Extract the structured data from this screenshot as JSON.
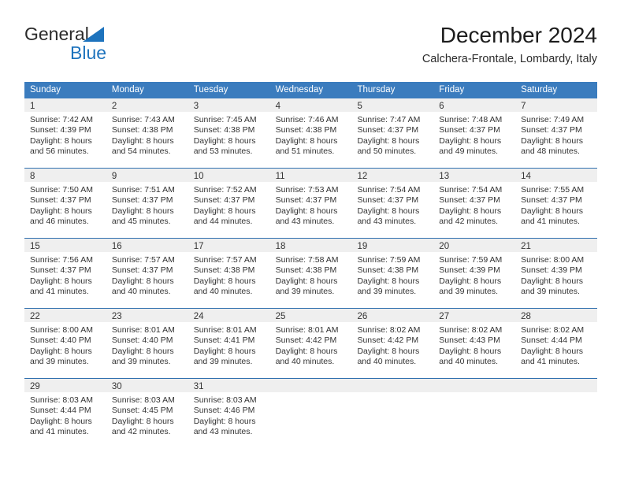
{
  "brand": {
    "name_part1": "General",
    "name_part2": "Blue",
    "icon": "triangle-logo-icon",
    "color_primary": "#1d73bd",
    "color_text": "#2b2b2b"
  },
  "header": {
    "title": "December 2024",
    "subtitle": "Calchera-Frontale, Lombardy, Italy"
  },
  "theme": {
    "header_blue": "#3b7cbe",
    "row_divider_blue": "#2f6fae",
    "day_band_gray": "#efefef",
    "text": "#333333"
  },
  "weekdays": [
    "Sunday",
    "Monday",
    "Tuesday",
    "Wednesday",
    "Thursday",
    "Friday",
    "Saturday"
  ],
  "weeks": [
    [
      {
        "day": "1",
        "sunrise": "Sunrise: 7:42 AM",
        "sunset": "Sunset: 4:39 PM",
        "daylight_1": "Daylight: 8 hours",
        "daylight_2": "and 56 minutes."
      },
      {
        "day": "2",
        "sunrise": "Sunrise: 7:43 AM",
        "sunset": "Sunset: 4:38 PM",
        "daylight_1": "Daylight: 8 hours",
        "daylight_2": "and 54 minutes."
      },
      {
        "day": "3",
        "sunrise": "Sunrise: 7:45 AM",
        "sunset": "Sunset: 4:38 PM",
        "daylight_1": "Daylight: 8 hours",
        "daylight_2": "and 53 minutes."
      },
      {
        "day": "4",
        "sunrise": "Sunrise: 7:46 AM",
        "sunset": "Sunset: 4:38 PM",
        "daylight_1": "Daylight: 8 hours",
        "daylight_2": "and 51 minutes."
      },
      {
        "day": "5",
        "sunrise": "Sunrise: 7:47 AM",
        "sunset": "Sunset: 4:37 PM",
        "daylight_1": "Daylight: 8 hours",
        "daylight_2": "and 50 minutes."
      },
      {
        "day": "6",
        "sunrise": "Sunrise: 7:48 AM",
        "sunset": "Sunset: 4:37 PM",
        "daylight_1": "Daylight: 8 hours",
        "daylight_2": "and 49 minutes."
      },
      {
        "day": "7",
        "sunrise": "Sunrise: 7:49 AM",
        "sunset": "Sunset: 4:37 PM",
        "daylight_1": "Daylight: 8 hours",
        "daylight_2": "and 48 minutes."
      }
    ],
    [
      {
        "day": "8",
        "sunrise": "Sunrise: 7:50 AM",
        "sunset": "Sunset: 4:37 PM",
        "daylight_1": "Daylight: 8 hours",
        "daylight_2": "and 46 minutes."
      },
      {
        "day": "9",
        "sunrise": "Sunrise: 7:51 AM",
        "sunset": "Sunset: 4:37 PM",
        "daylight_1": "Daylight: 8 hours",
        "daylight_2": "and 45 minutes."
      },
      {
        "day": "10",
        "sunrise": "Sunrise: 7:52 AM",
        "sunset": "Sunset: 4:37 PM",
        "daylight_1": "Daylight: 8 hours",
        "daylight_2": "and 44 minutes."
      },
      {
        "day": "11",
        "sunrise": "Sunrise: 7:53 AM",
        "sunset": "Sunset: 4:37 PM",
        "daylight_1": "Daylight: 8 hours",
        "daylight_2": "and 43 minutes."
      },
      {
        "day": "12",
        "sunrise": "Sunrise: 7:54 AM",
        "sunset": "Sunset: 4:37 PM",
        "daylight_1": "Daylight: 8 hours",
        "daylight_2": "and 43 minutes."
      },
      {
        "day": "13",
        "sunrise": "Sunrise: 7:54 AM",
        "sunset": "Sunset: 4:37 PM",
        "daylight_1": "Daylight: 8 hours",
        "daylight_2": "and 42 minutes."
      },
      {
        "day": "14",
        "sunrise": "Sunrise: 7:55 AM",
        "sunset": "Sunset: 4:37 PM",
        "daylight_1": "Daylight: 8 hours",
        "daylight_2": "and 41 minutes."
      }
    ],
    [
      {
        "day": "15",
        "sunrise": "Sunrise: 7:56 AM",
        "sunset": "Sunset: 4:37 PM",
        "daylight_1": "Daylight: 8 hours",
        "daylight_2": "and 41 minutes."
      },
      {
        "day": "16",
        "sunrise": "Sunrise: 7:57 AM",
        "sunset": "Sunset: 4:37 PM",
        "daylight_1": "Daylight: 8 hours",
        "daylight_2": "and 40 minutes."
      },
      {
        "day": "17",
        "sunrise": "Sunrise: 7:57 AM",
        "sunset": "Sunset: 4:38 PM",
        "daylight_1": "Daylight: 8 hours",
        "daylight_2": "and 40 minutes."
      },
      {
        "day": "18",
        "sunrise": "Sunrise: 7:58 AM",
        "sunset": "Sunset: 4:38 PM",
        "daylight_1": "Daylight: 8 hours",
        "daylight_2": "and 39 minutes."
      },
      {
        "day": "19",
        "sunrise": "Sunrise: 7:59 AM",
        "sunset": "Sunset: 4:38 PM",
        "daylight_1": "Daylight: 8 hours",
        "daylight_2": "and 39 minutes."
      },
      {
        "day": "20",
        "sunrise": "Sunrise: 7:59 AM",
        "sunset": "Sunset: 4:39 PM",
        "daylight_1": "Daylight: 8 hours",
        "daylight_2": "and 39 minutes."
      },
      {
        "day": "21",
        "sunrise": "Sunrise: 8:00 AM",
        "sunset": "Sunset: 4:39 PM",
        "daylight_1": "Daylight: 8 hours",
        "daylight_2": "and 39 minutes."
      }
    ],
    [
      {
        "day": "22",
        "sunrise": "Sunrise: 8:00 AM",
        "sunset": "Sunset: 4:40 PM",
        "daylight_1": "Daylight: 8 hours",
        "daylight_2": "and 39 minutes."
      },
      {
        "day": "23",
        "sunrise": "Sunrise: 8:01 AM",
        "sunset": "Sunset: 4:40 PM",
        "daylight_1": "Daylight: 8 hours",
        "daylight_2": "and 39 minutes."
      },
      {
        "day": "24",
        "sunrise": "Sunrise: 8:01 AM",
        "sunset": "Sunset: 4:41 PM",
        "daylight_1": "Daylight: 8 hours",
        "daylight_2": "and 39 minutes."
      },
      {
        "day": "25",
        "sunrise": "Sunrise: 8:01 AM",
        "sunset": "Sunset: 4:42 PM",
        "daylight_1": "Daylight: 8 hours",
        "daylight_2": "and 40 minutes."
      },
      {
        "day": "26",
        "sunrise": "Sunrise: 8:02 AM",
        "sunset": "Sunset: 4:42 PM",
        "daylight_1": "Daylight: 8 hours",
        "daylight_2": "and 40 minutes."
      },
      {
        "day": "27",
        "sunrise": "Sunrise: 8:02 AM",
        "sunset": "Sunset: 4:43 PM",
        "daylight_1": "Daylight: 8 hours",
        "daylight_2": "and 40 minutes."
      },
      {
        "day": "28",
        "sunrise": "Sunrise: 8:02 AM",
        "sunset": "Sunset: 4:44 PM",
        "daylight_1": "Daylight: 8 hours",
        "daylight_2": "and 41 minutes."
      }
    ],
    [
      {
        "day": "29",
        "sunrise": "Sunrise: 8:03 AM",
        "sunset": "Sunset: 4:44 PM",
        "daylight_1": "Daylight: 8 hours",
        "daylight_2": "and 41 minutes."
      },
      {
        "day": "30",
        "sunrise": "Sunrise: 8:03 AM",
        "sunset": "Sunset: 4:45 PM",
        "daylight_1": "Daylight: 8 hours",
        "daylight_2": "and 42 minutes."
      },
      {
        "day": "31",
        "sunrise": "Sunrise: 8:03 AM",
        "sunset": "Sunset: 4:46 PM",
        "daylight_1": "Daylight: 8 hours",
        "daylight_2": "and 43 minutes."
      },
      {
        "day": "",
        "sunrise": "",
        "sunset": "",
        "daylight_1": "",
        "daylight_2": ""
      },
      {
        "day": "",
        "sunrise": "",
        "sunset": "",
        "daylight_1": "",
        "daylight_2": ""
      },
      {
        "day": "",
        "sunrise": "",
        "sunset": "",
        "daylight_1": "",
        "daylight_2": ""
      },
      {
        "day": "",
        "sunrise": "",
        "sunset": "",
        "daylight_1": "",
        "daylight_2": ""
      }
    ]
  ]
}
